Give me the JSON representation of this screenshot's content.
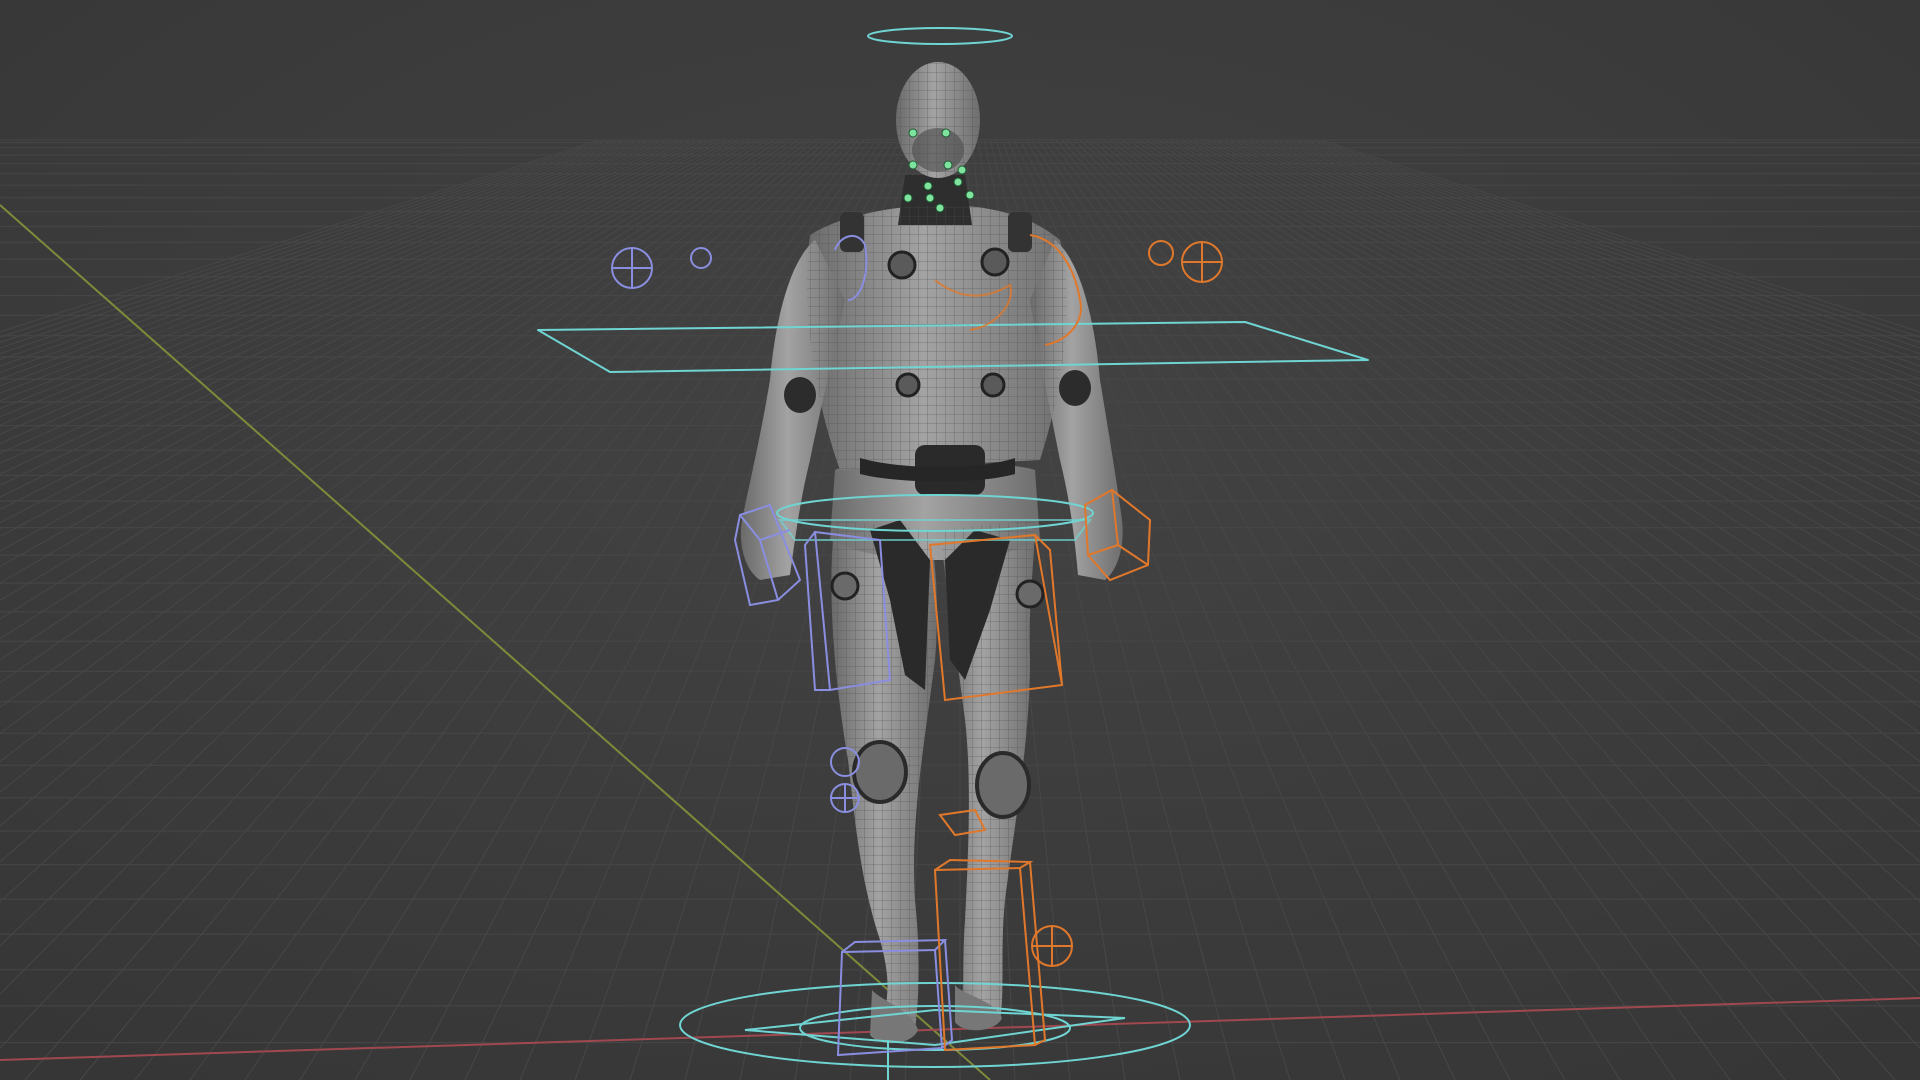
{
  "viewport": {
    "kind": "3d-viewport",
    "view": "perspective",
    "object": "character-rig",
    "shading": "wireframe-on-solid",
    "colors": {
      "background": "#3d3d3d",
      "grid_line": "#474747",
      "x_axis": "#a04850",
      "y_axis": "#7e8a3a",
      "body_fill": "#8c8c8c",
      "body_dark": "#2a2a2a",
      "wire": "#555555",
      "control_cyan": "#6fd4d2",
      "control_left": "#8a8ee0",
      "control_right": "#e0782c",
      "face_control": "#7fe3a0"
    },
    "controls": [
      "root-circle-control",
      "torso-plane-control",
      "hips-ring-control",
      "head-top-ring-control",
      "left-hand-ik-box",
      "right-hand-ik-box",
      "left-thigh-box",
      "right-thigh-box",
      "left-foot-ik-box",
      "right-foot-ik-box",
      "left-arm-pole-target",
      "right-arm-pole-target",
      "left-knee-pole-target",
      "right-knee-pole-target",
      "face-controls"
    ]
  }
}
